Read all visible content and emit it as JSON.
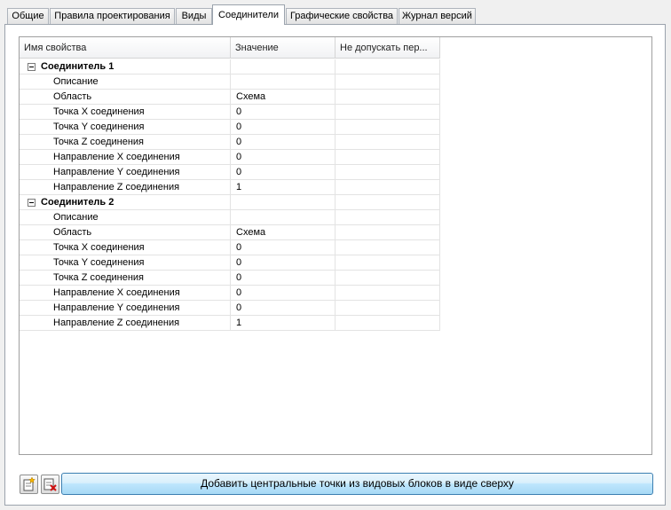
{
  "tabs": [
    {
      "label": "Общие"
    },
    {
      "label": "Правила проектирования"
    },
    {
      "label": "Виды"
    },
    {
      "label": "Соединители",
      "active": true
    },
    {
      "label": "Графические свойства"
    },
    {
      "label": "Журнал версий"
    }
  ],
  "grid": {
    "columns": [
      "Имя свойства",
      "Значение",
      "Не допускать пер..."
    ],
    "groups": [
      {
        "name": "Соединитель 1",
        "rows": [
          {
            "name": "Описание",
            "value": ""
          },
          {
            "name": "Область",
            "value": "Схема"
          },
          {
            "name": "Точка X соединения",
            "value": "0"
          },
          {
            "name": "Точка Y соединения",
            "value": "0"
          },
          {
            "name": "Точка Z соединения",
            "value": "0"
          },
          {
            "name": "Направление X соединения",
            "value": "0"
          },
          {
            "name": "Направление Y соединения",
            "value": "0"
          },
          {
            "name": "Направление Z соединения",
            "value": "1"
          }
        ]
      },
      {
        "name": "Соединитель 2",
        "rows": [
          {
            "name": "Описание",
            "value": ""
          },
          {
            "name": "Область",
            "value": "Схема"
          },
          {
            "name": "Точка X соединения",
            "value": "0"
          },
          {
            "name": "Точка Y соединения",
            "value": "0"
          },
          {
            "name": "Точка Z соединения",
            "value": "0"
          },
          {
            "name": "Направление X соединения",
            "value": "0"
          },
          {
            "name": "Направление Y соединения",
            "value": "0"
          },
          {
            "name": "Направление Z соединения",
            "value": "1"
          }
        ]
      }
    ]
  },
  "buttons": {
    "add_icon": "add-connector-icon",
    "delete_icon": "delete-connector-icon",
    "main_label": "Добавить центральные точки из видовых блоков в виде сверху"
  }
}
